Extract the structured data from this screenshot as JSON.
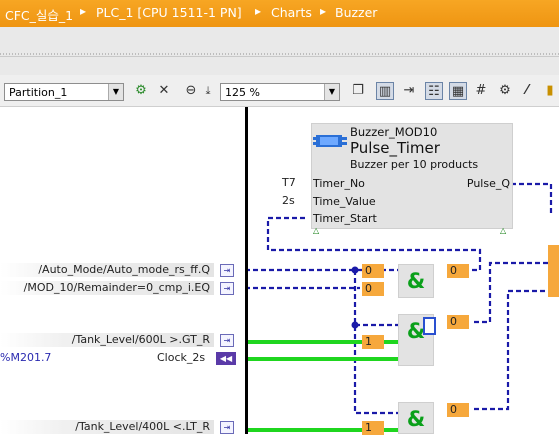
{
  "titlebar": {
    "crumbs": [
      "CFC_실습_1",
      "PLC_1 [CPU 1511-1 PN]",
      "Charts",
      "Buzzer"
    ],
    "separator": "▸"
  },
  "toolbar": {
    "partition_value": "Partition_1",
    "zoom_value": "125 %",
    "icons": [
      "add-gear-icon",
      "close-icon",
      "zoom-out-icon",
      "zoom-in-icon",
      "page-icon",
      "columns-icon",
      "split-icon",
      "layout-a-icon",
      "layout-b-icon",
      "grid-icon",
      "gear-icon",
      "formula-icon",
      "lock-icon"
    ]
  },
  "block": {
    "type": "Buzzer_MOD10",
    "name": "Pulse_Timer",
    "comment": "Buzzer per 10 products",
    "inputs": [
      {
        "value": "T7",
        "name": "Timer_No"
      },
      {
        "value": "2s",
        "name": "Time_Value"
      },
      {
        "value": "",
        "name": "Timer_Start"
      }
    ],
    "outputs": [
      {
        "name": "Pulse_Q"
      }
    ]
  },
  "signals": [
    {
      "label": "/Auto_Mode/Auto_mode_rs_ff.Q"
    },
    {
      "label": "/MOD_10/Remainder=0_cmp_i.EQ"
    },
    {
      "label": "/Tank_Level/600L >.GT_R"
    },
    {
      "address": "%M201.7",
      "label": "Clock_2s"
    },
    {
      "label": "/Tank_Level/400L <.LT_R"
    }
  ],
  "and_gates": [
    {
      "symbol": "&",
      "inputs": [
        "0",
        "0"
      ],
      "output": "0"
    },
    {
      "symbol": "&",
      "inputs": [
        "1"
      ],
      "output": "0"
    },
    {
      "symbol": "&",
      "inputs": [
        "1"
      ],
      "output": "0"
    }
  ],
  "colors": {
    "accent": "#f39c1a",
    "wire": "#1a1aa8",
    "signal_true": "#1fd61f"
  }
}
